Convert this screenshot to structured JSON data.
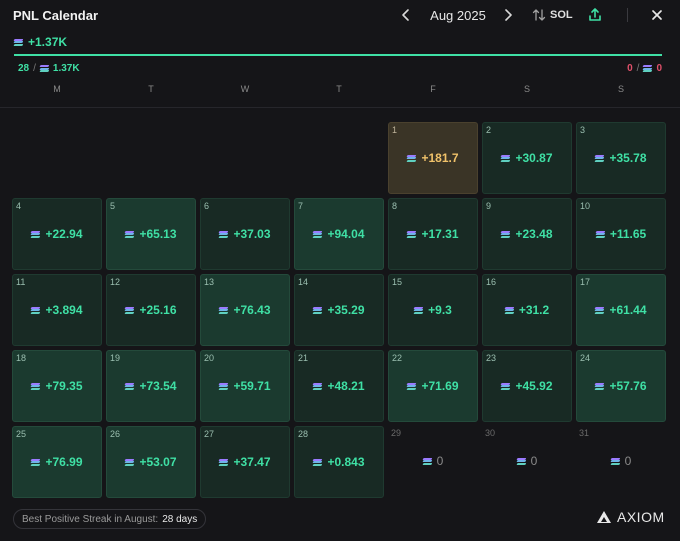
{
  "header": {
    "title": "PNL Calendar",
    "month": "Aug 2025",
    "currency": "SOL",
    "prev_icon": "chevron-left-icon",
    "next_icon": "chevron-right-icon",
    "swap_icon": "swap-vertical-icon",
    "share_icon": "share-upload-icon",
    "close_icon": "close-icon"
  },
  "summary": {
    "total": "+1.37K",
    "positive_days": "28",
    "positive_total": "1.37K",
    "negative_days": "0",
    "negative_total": "0",
    "positive_ratio": 1.0
  },
  "weekdays": [
    "M",
    "T",
    "W",
    "T",
    "F",
    "S",
    "S"
  ],
  "leading_empty_days": 4,
  "days": [
    {
      "day": "1",
      "pnl": "+181.7",
      "state": "best"
    },
    {
      "day": "2",
      "pnl": "+30.87",
      "state": "pos-dim"
    },
    {
      "day": "3",
      "pnl": "+35.78",
      "state": "pos-dim"
    },
    {
      "day": "4",
      "pnl": "+22.94",
      "state": "pos-dim"
    },
    {
      "day": "5",
      "pnl": "+65.13",
      "state": "pos"
    },
    {
      "day": "6",
      "pnl": "+37.03",
      "state": "pos-dim"
    },
    {
      "day": "7",
      "pnl": "+94.04",
      "state": "pos"
    },
    {
      "day": "8",
      "pnl": "+17.31",
      "state": "pos-dim"
    },
    {
      "day": "9",
      "pnl": "+23.48",
      "state": "pos-dim"
    },
    {
      "day": "10",
      "pnl": "+11.65",
      "state": "pos-dim"
    },
    {
      "day": "11",
      "pnl": "+3.894",
      "state": "pos-dim"
    },
    {
      "day": "12",
      "pnl": "+25.16",
      "state": "pos-dim"
    },
    {
      "day": "13",
      "pnl": "+76.43",
      "state": "pos"
    },
    {
      "day": "14",
      "pnl": "+35.29",
      "state": "pos-dim"
    },
    {
      "day": "15",
      "pnl": "+9.3",
      "state": "pos-dim"
    },
    {
      "day": "16",
      "pnl": "+31.2",
      "state": "pos-dim"
    },
    {
      "day": "17",
      "pnl": "+61.44",
      "state": "pos"
    },
    {
      "day": "18",
      "pnl": "+79.35",
      "state": "pos"
    },
    {
      "day": "19",
      "pnl": "+73.54",
      "state": "pos"
    },
    {
      "day": "20",
      "pnl": "+59.71",
      "state": "pos"
    },
    {
      "day": "21",
      "pnl": "+48.21",
      "state": "pos-dim"
    },
    {
      "day": "22",
      "pnl": "+71.69",
      "state": "pos"
    },
    {
      "day": "23",
      "pnl": "+45.92",
      "state": "pos-dim"
    },
    {
      "day": "24",
      "pnl": "+57.76",
      "state": "pos"
    },
    {
      "day": "25",
      "pnl": "+76.99",
      "state": "pos"
    },
    {
      "day": "26",
      "pnl": "+53.07",
      "state": "pos"
    },
    {
      "day": "27",
      "pnl": "+37.47",
      "state": "pos-dim"
    },
    {
      "day": "28",
      "pnl": "+0.843",
      "state": "pos-dim"
    },
    {
      "day": "29",
      "pnl": "0",
      "state": "zero"
    },
    {
      "day": "30",
      "pnl": "0",
      "state": "zero"
    },
    {
      "day": "31",
      "pnl": "0",
      "state": "zero"
    }
  ],
  "footer": {
    "streak_label": "Best Positive Streak in August:",
    "streak_value": "28 days",
    "brand": "AXIOM",
    "brand_icon": "axiom-logo-icon"
  },
  "colors": {
    "accent_positive": "#3fe0a5",
    "accent_negative": "#e0506a",
    "best_day": "#f0c26a",
    "background": "#151518"
  }
}
